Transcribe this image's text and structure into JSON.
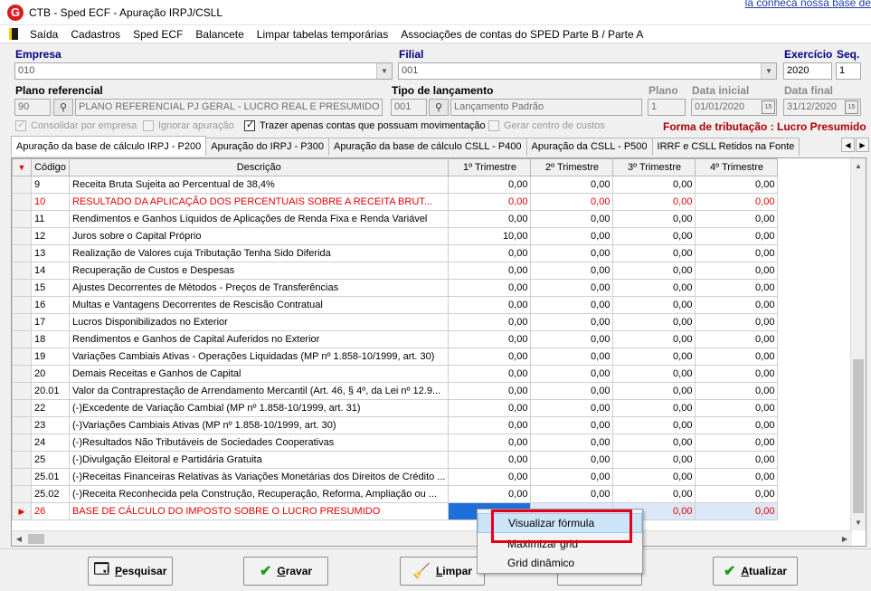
{
  "window": {
    "title": "CTB - Sped ECF - Apuração IRPJ/CSLL",
    "background_link": "la conheca nossa base de"
  },
  "menu": [
    "Saída",
    "Cadastros",
    "Sped ECF",
    "Balancete",
    "Limpar tabelas temporárias",
    "Associações de contas do SPED Parte B / Parte A"
  ],
  "form": {
    "empresa_label": "Empresa",
    "empresa_value": "010",
    "filial_label": "Filial",
    "filial_value": "001",
    "exercicio_label": "Exercício",
    "exercicio_value": "2020",
    "seq_label": "Seq.",
    "seq_value": "1",
    "plano_ref_label": "Plano referencial",
    "plano_ref_code": "90",
    "plano_ref_desc": "PLANO REFERENCIAL PJ GERAL - LUCRO REAL E PRESUMIDO AN",
    "tipo_lanc_label": "Tipo de lançamento",
    "tipo_lanc_code": "001",
    "tipo_lanc_desc": "Lançamento Padrão",
    "plano_label": "Plano",
    "plano_value": "1",
    "data_inicial_label": "Data inicial",
    "data_inicial_value": "01/01/2020",
    "data_final_label": "Data final",
    "data_final_value": "31/12/2020",
    "chk_consolidar": "Consolidar por empresa",
    "chk_ignorar": "Ignorar apuração",
    "chk_trazer": "Trazer apenas contas que possuam movimentação",
    "chk_gerar": "Gerar centro de custos",
    "forma_tributacao": "Forma de tributação : Lucro Presumido"
  },
  "tabs": [
    "Apuração da base de cálculo IRPJ - P200",
    "Apuração do IRPJ - P300",
    "Apuração da base de cálculo CSLL - P400",
    "Apuração da CSLL - P500",
    "IRRF e CSLL Retidos na Fonte"
  ],
  "grid": {
    "headers": [
      "Código",
      "Descrição",
      "1º Trimestre",
      "2º Trimestre",
      "3º Trimestre",
      "4º Trimestre"
    ],
    "rows": [
      {
        "code": "9",
        "desc": "Receita Bruta Sujeita ao Percentual de 38,4%",
        "q": [
          "0,00",
          "0,00",
          "0,00",
          "0,00"
        ],
        "red": false
      },
      {
        "code": "10",
        "desc": "RESULTADO DA APLICAÇÃO DOS PERCENTUAIS SOBRE A RECEITA BRUT...",
        "q": [
          "0,00",
          "0,00",
          "0,00",
          "0,00"
        ],
        "red": true
      },
      {
        "code": "11",
        "desc": "Rendimentos e Ganhos Líquidos de Aplicações de Renda Fixa e Renda Variável",
        "q": [
          "0,00",
          "0,00",
          "0,00",
          "0,00"
        ],
        "red": false
      },
      {
        "code": "12",
        "desc": "Juros sobre o Capital Próprio",
        "q": [
          "10,00",
          "0,00",
          "0,00",
          "0,00"
        ],
        "red": false
      },
      {
        "code": "13",
        "desc": "Realização de Valores cuja Tributação Tenha Sido Diferida",
        "q": [
          "0,00",
          "0,00",
          "0,00",
          "0,00"
        ],
        "red": false
      },
      {
        "code": "14",
        "desc": "Recuperação de Custos e Despesas",
        "q": [
          "0,00",
          "0,00",
          "0,00",
          "0,00"
        ],
        "red": false
      },
      {
        "code": "15",
        "desc": "Ajustes Decorrentes de Métodos - Preços de Transferências",
        "q": [
          "0,00",
          "0,00",
          "0,00",
          "0,00"
        ],
        "red": false
      },
      {
        "code": "16",
        "desc": "Multas e Vantagens Decorrentes de Rescisão Contratual",
        "q": [
          "0,00",
          "0,00",
          "0,00",
          "0,00"
        ],
        "red": false
      },
      {
        "code": "17",
        "desc": "Lucros Disponibilizados no Exterior",
        "q": [
          "0,00",
          "0,00",
          "0,00",
          "0,00"
        ],
        "red": false
      },
      {
        "code": "18",
        "desc": "Rendimentos e Ganhos de Capital Auferidos no Exterior",
        "q": [
          "0,00",
          "0,00",
          "0,00",
          "0,00"
        ],
        "red": false
      },
      {
        "code": "19",
        "desc": "Variações Cambiais Ativas - Operações Liquidadas (MP nº 1.858-10/1999, art. 30)",
        "q": [
          "0,00",
          "0,00",
          "0,00",
          "0,00"
        ],
        "red": false
      },
      {
        "code": "20",
        "desc": "Demais Receitas e Ganhos de Capital",
        "q": [
          "0,00",
          "0,00",
          "0,00",
          "0,00"
        ],
        "red": false
      },
      {
        "code": "20.01",
        "desc": "Valor da Contraprestação de Arrendamento Mercantil (Art. 46, § 4º, da Lei nº 12.9...",
        "q": [
          "0,00",
          "0,00",
          "0,00",
          "0,00"
        ],
        "red": false
      },
      {
        "code": "22",
        "desc": "(-)Excedente de Variação Cambial (MP nº 1.858-10/1999, art. 31)",
        "q": [
          "0,00",
          "0,00",
          "0,00",
          "0,00"
        ],
        "red": false
      },
      {
        "code": "23",
        "desc": "(-)Variações Cambiais Ativas (MP nº 1.858-10/1999, art. 30)",
        "q": [
          "0,00",
          "0,00",
          "0,00",
          "0,00"
        ],
        "red": false
      },
      {
        "code": "24",
        "desc": "(-)Resultados Não Tributáveis de Sociedades Cooperativas",
        "q": [
          "0,00",
          "0,00",
          "0,00",
          "0,00"
        ],
        "red": false
      },
      {
        "code": "25",
        "desc": "(-)Divulgação Eleitoral e Partidária Gratuita",
        "q": [
          "0,00",
          "0,00",
          "0,00",
          "0,00"
        ],
        "red": false
      },
      {
        "code": "25.01",
        "desc": "(-)Receitas Financeiras Relativas às Variações Monetárias dos Direitos de Crédito ...",
        "q": [
          "0,00",
          "0,00",
          "0,00",
          "0,00"
        ],
        "red": false
      },
      {
        "code": "25.02",
        "desc": "(-)Receita Reconhecida pela Construção, Recuperação, Reforma, Ampliação ou ...",
        "q": [
          "0,00",
          "0,00",
          "0,00",
          "0,00"
        ],
        "red": false
      },
      {
        "code": "26",
        "desc": "BASE DE CÁLCULO DO IMPOSTO SOBRE O LUCRO PRESUMIDO",
        "q": [
          "",
          "",
          "0,00",
          "0,00"
        ],
        "red": true,
        "current": true
      }
    ]
  },
  "context_menu": [
    "Visualizar fórmula",
    "Maximizar grid",
    "Grid dinâmico"
  ],
  "buttons": {
    "pesquisar_p1": "P",
    "pesquisar_p2": "esquisar",
    "gravar_p1": "G",
    "gravar_p2": "ravar",
    "limpar_p1": "L",
    "limpar_p2": "impar",
    "atualizar_p1": "A",
    "atualizar_p2": "tualizar"
  },
  "colors": {
    "accent_red": "#e00000",
    "label_blue": "#000080",
    "selection_blue": "#1e6fd9"
  }
}
